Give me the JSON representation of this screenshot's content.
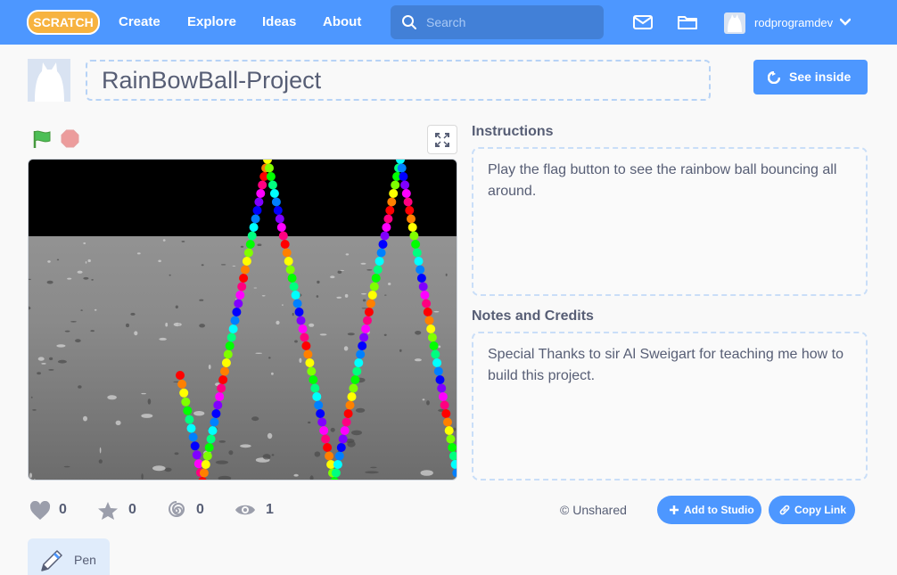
{
  "nav": {
    "logo_text": "SCRATCH",
    "links": [
      "Create",
      "Explore",
      "Ideas",
      "About"
    ],
    "search_placeholder": "Search",
    "username": "rodprogramdev"
  },
  "project": {
    "title": "RainBowBall-Project",
    "see_inside_label": "See inside"
  },
  "instructions": {
    "heading": "Instructions",
    "text": "Play the flag button to see the rainbow ball bouncing all around."
  },
  "notes": {
    "heading": "Notes and Credits",
    "text": "Special Thanks to sir Al Sweigart for teaching me how to build this project."
  },
  "stats": {
    "loves": "0",
    "favorites": "0",
    "remixes": "0",
    "views": "1"
  },
  "share": {
    "status": "© Unshared",
    "add_to_studio": "Add to Studio",
    "copy_link": "Copy Link"
  },
  "extensions": [
    "Pen"
  ],
  "colors": {
    "brand_blue": "#4d97ff",
    "search_bg": "#4280d7",
    "text": "#575e75",
    "flag_green": "#4cbf56",
    "stop_red": "#ec9c9c",
    "rainbow": [
      "#ff0000",
      "#ff8000",
      "#ffff00",
      "#80ff00",
      "#00ff00",
      "#00ff80",
      "#00ffff",
      "#0080ff",
      "#0000ff",
      "#8000ff",
      "#ff00ff",
      "#ff0080"
    ]
  }
}
